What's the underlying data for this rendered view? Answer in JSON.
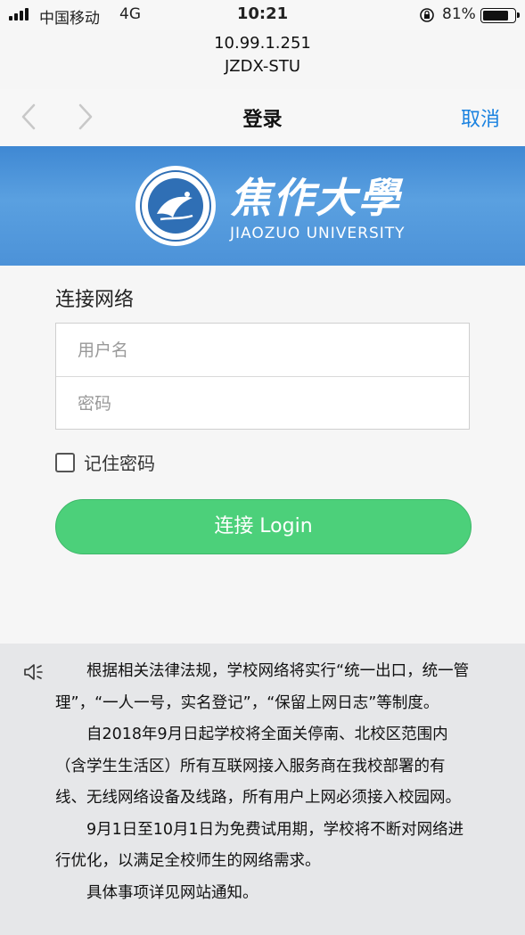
{
  "status_bar": {
    "carrier": "中国移动",
    "network": "4G",
    "time": "10:21",
    "battery": "81%",
    "battery_level": 0.81
  },
  "address": {
    "ip": "10.99.1.251",
    "ssid": "JZDX-STU"
  },
  "navbar": {
    "title": "登录",
    "cancel": "取消"
  },
  "banner": {
    "name_cn": "焦作大學",
    "name_en": "JIAOZUO UNIVERSITY"
  },
  "login": {
    "title": "连接网络",
    "username_placeholder": "用户名",
    "username_value": "",
    "password_placeholder": "密码",
    "password_value": "",
    "remember_label": "记住密码",
    "remember_checked": false,
    "button_label": "连接 Login"
  },
  "notice": {
    "icon": "speaker-icon",
    "paragraphs": [
      "根据相关法律法规，学校网络将实行“统一出口，统一管理”，“一人一号，实名登记”，“保留上网日志”等制度。",
      "自2018年9月日起学校将全面关停南、北校区范围内（含学生生活区）所有互联网接入服务商在我校部署的有线、无线网络设备及线路，所有用户上网必须接入校园网。",
      "9月1日至10月1日为免费试用期，学校将不断对网络进行优化，以满足全校师生的网络需求。",
      "具体事项详见网站通知。"
    ]
  },
  "colors": {
    "accent": "#1a82e0",
    "button": "#4cd07a",
    "banner": "#4a90d9",
    "notice_bg": "#e6e7e9"
  }
}
